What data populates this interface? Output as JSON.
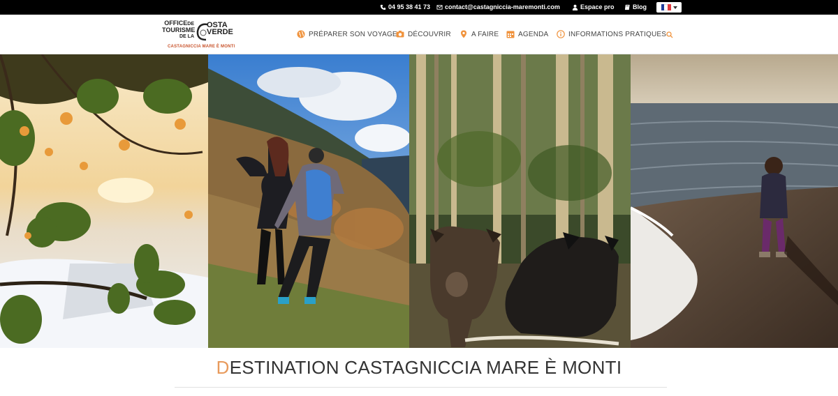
{
  "topbar": {
    "phone": "04 95 38 41 73",
    "email": "contact@castagniccia-maremonti.com",
    "espace_pro": "Espace pro",
    "blog": "Blog",
    "language_flag_colors": [
      "#1f3c9a",
      "#ffffff",
      "#e03a3e"
    ]
  },
  "logo": {
    "line1": "OFFICE",
    "line1b": "DE",
    "line2": "TOURISME",
    "line3": "DE LA",
    "costa": "OSTA",
    "verde": "VERDE",
    "sub": "CASTAGNICCIA MARE È MONTI",
    "accent": "#c8532b"
  },
  "nav": {
    "items": [
      {
        "label": "PRÉPARER SON VOYAGE",
        "icon": "globe-icon"
      },
      {
        "label": "DÉCOUVRIR",
        "icon": "camera-icon"
      },
      {
        "label": "A FAIRE",
        "icon": "map-pin-icon"
      },
      {
        "label": "AGENDA",
        "icon": "calendar-icon"
      },
      {
        "label": "INFORMATIONS PRATIQUES",
        "icon": "info-icon"
      }
    ],
    "icon_color": "#f0933d"
  },
  "hero": {
    "panels": [
      "citrus-snow-photo",
      "hikers-mountain-photo",
      "wild-boars-forest-photo",
      "child-beach-photo"
    ]
  },
  "title": {
    "first_letter": "D",
    "rest": "ESTINATION CASTAGNICCIA MARE È MONTI",
    "accent": "#e89a5c"
  }
}
